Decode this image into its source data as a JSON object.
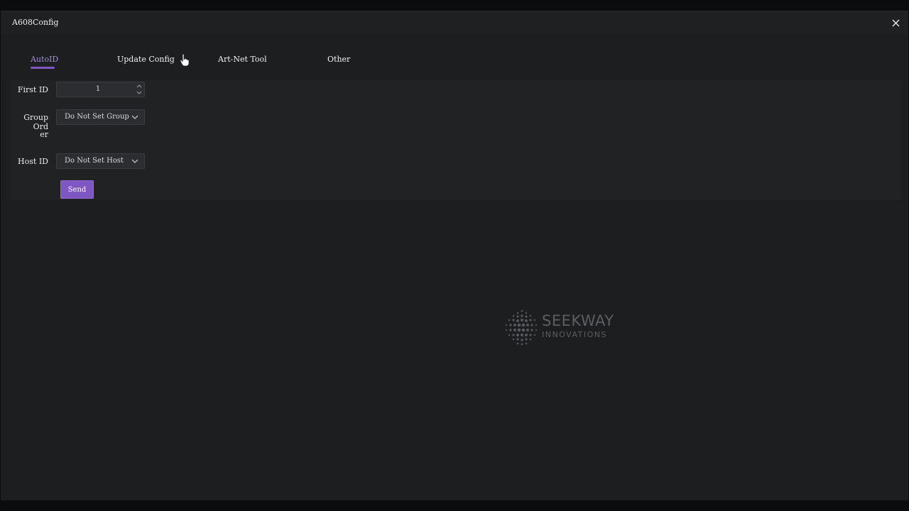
{
  "window": {
    "title": "A608Config",
    "close_icon": "close-icon"
  },
  "tabs": [
    {
      "label": "AutoID",
      "active": true
    },
    {
      "label": "Update Config",
      "active": false
    },
    {
      "label": "Art-Net Tool",
      "active": false
    },
    {
      "label": "Other",
      "active": false
    }
  ],
  "form": {
    "first_id": {
      "label": "First ID",
      "value": "1"
    },
    "group_order": {
      "label_line1": "Group Ord",
      "label_line2": "er",
      "value": "Do Not Set Group"
    },
    "host_id": {
      "label": "Host ID",
      "value": "Do Not Set Host"
    },
    "send_label": "Send"
  },
  "logo": {
    "line1": "SEEKWAY",
    "line2": "INNOVATIONS"
  },
  "colors": {
    "accent": "#7e57c2",
    "active_tab_text": "#a78bdb",
    "background": "#1c1e20",
    "panel": "#202224"
  }
}
